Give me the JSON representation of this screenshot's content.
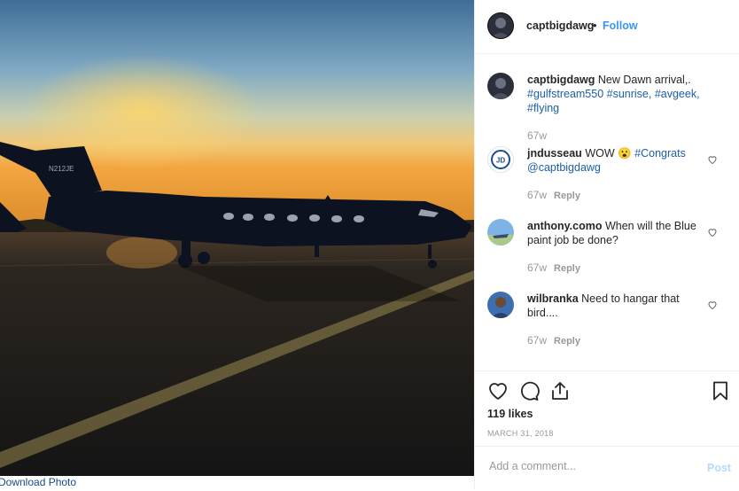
{
  "photo": {
    "alt": "Gulfstream jet at sunrise",
    "tail_number": "N212JE"
  },
  "download_link": "Download Photo",
  "header": {
    "username": "captbigdawg",
    "separator": "•",
    "follow_label": "Follow"
  },
  "caption": {
    "username": "captbigdawg",
    "text": "New Dawn arrival,.",
    "hashtags": "#gulfstream550 #sunrise, #avgeek, #flying",
    "time": "67w"
  },
  "comments": [
    {
      "username": "jndusseau",
      "text": "WOW 😮",
      "tag": "#Congrats @captbigdawg",
      "time": "67w",
      "reply_label": "Reply"
    },
    {
      "username": "anthony.como",
      "text": "When will the Blue paint job be done?",
      "time": "67w",
      "reply_label": "Reply"
    },
    {
      "username": "wilbranka",
      "text": "Need to hangar that bird....",
      "time": "67w",
      "reply_label": "Reply"
    }
  ],
  "actions": {
    "likes": "119 likes",
    "date": "MARCH 31, 2018"
  },
  "add_comment": {
    "placeholder": "Add a comment...",
    "post_label": "Post"
  },
  "colors": {
    "link_blue": "#3897f0",
    "hashtag_blue": "#1a5ea8",
    "muted": "#999999",
    "post_disabled": "#b3dbff"
  },
  "icons": [
    "heart-icon",
    "comment-icon",
    "share-icon",
    "bookmark-icon"
  ]
}
